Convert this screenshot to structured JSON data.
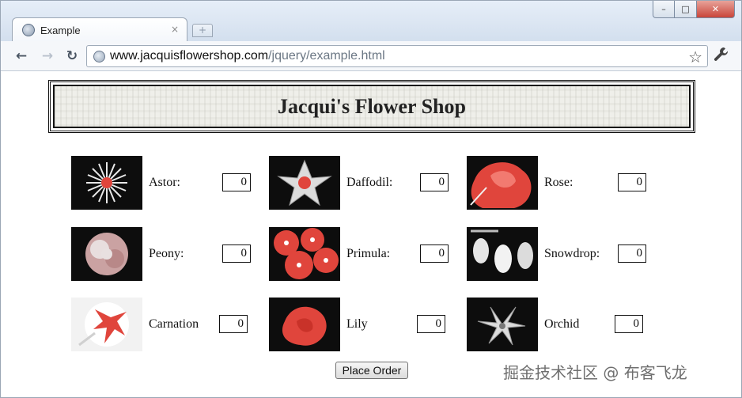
{
  "browser": {
    "tab_title": "Example",
    "tab_close": "×",
    "new_tab": "+",
    "url_host": "www.jacquisflowershop.com",
    "url_path": "/jquery/example.html",
    "back_icon": "←",
    "forward_icon": "→",
    "reload_icon": "↻",
    "star_icon": "☆",
    "wrench_icon": "🔧",
    "window_min": "–",
    "window_max": "□",
    "window_close": "✕"
  },
  "page": {
    "title": "Jacqui's Flower Shop",
    "order_button": "Place Order"
  },
  "products": [
    {
      "name": "Astor:",
      "qty": "0",
      "icon": "astor-flower"
    },
    {
      "name": "Daffodil:",
      "qty": "0",
      "icon": "daffodil-flower"
    },
    {
      "name": "Rose:",
      "qty": "0",
      "icon": "rose-flower"
    },
    {
      "name": "Peony:",
      "qty": "0",
      "icon": "peony-flower"
    },
    {
      "name": "Primula:",
      "qty": "0",
      "icon": "primula-flower"
    },
    {
      "name": "Snowdrop:",
      "qty": "0",
      "icon": "snowdrop-flower"
    },
    {
      "name": "Carnation",
      "qty": "0",
      "icon": "carnation-flower"
    },
    {
      "name": "Lily",
      "qty": "0",
      "icon": "lily-flower"
    },
    {
      "name": "Orchid",
      "qty": "0",
      "icon": "orchid-flower"
    }
  ],
  "watermark": "掘金技术社区 @ 布客飞龙",
  "colors": {
    "flower_red": "#e0453c",
    "thumb_bg": "#0d0d0d"
  }
}
